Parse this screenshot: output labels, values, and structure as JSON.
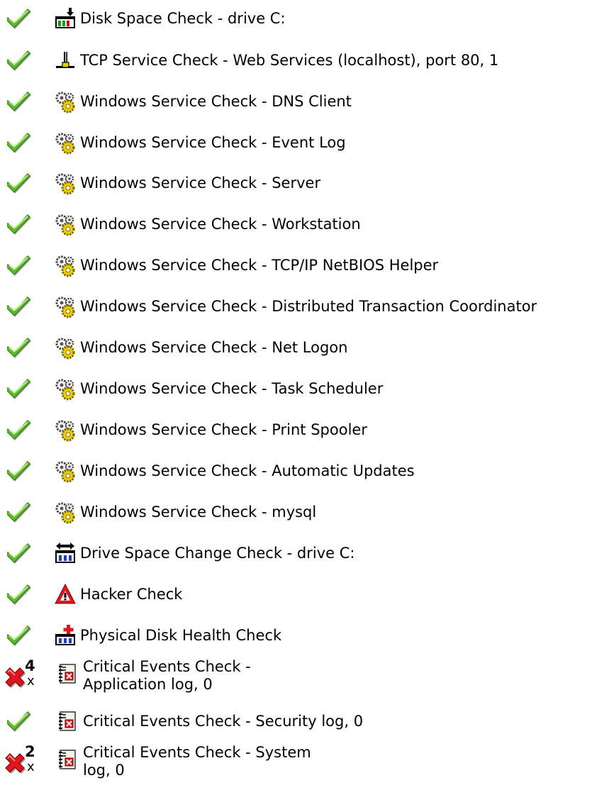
{
  "checks": [
    {
      "status": "ok",
      "icon": "disk-space-icon",
      "label": "Disk Space Check - drive C:"
    },
    {
      "status": "ok",
      "icon": "tcp-port-icon",
      "label": "TCP Service Check - Web Services (localhost), port 80, 1"
    },
    {
      "status": "ok",
      "icon": "gears-icon",
      "label": "Windows Service Check - DNS Client"
    },
    {
      "status": "ok",
      "icon": "gears-icon",
      "label": "Windows Service Check - Event Log"
    },
    {
      "status": "ok",
      "icon": "gears-icon",
      "label": "Windows Service Check - Server"
    },
    {
      "status": "ok",
      "icon": "gears-icon",
      "label": "Windows Service Check - Workstation"
    },
    {
      "status": "ok",
      "icon": "gears-icon",
      "label": "Windows Service Check - TCP/IP NetBIOS Helper"
    },
    {
      "status": "ok",
      "icon": "gears-icon",
      "label": "Windows Service Check - Distributed Transaction Coordinator"
    },
    {
      "status": "ok",
      "icon": "gears-icon",
      "label": "Windows Service Check - Net Logon"
    },
    {
      "status": "ok",
      "icon": "gears-icon",
      "label": "Windows Service Check - Task Scheduler"
    },
    {
      "status": "ok",
      "icon": "gears-icon",
      "label": "Windows Service Check - Print Spooler"
    },
    {
      "status": "ok",
      "icon": "gears-icon",
      "label": "Windows Service Check - Automatic Updates"
    },
    {
      "status": "ok",
      "icon": "gears-icon",
      "label": "Windows Service Check - mysql"
    },
    {
      "status": "ok",
      "icon": "drive-change-icon",
      "label": "Drive Space Change Check - drive C:"
    },
    {
      "status": "ok",
      "icon": "hacker-warning-icon",
      "label": "Hacker Check"
    },
    {
      "status": "ok",
      "icon": "disk-health-icon",
      "label": "Physical Disk Health Check"
    },
    {
      "status": "fail",
      "count": "4",
      "count_suffix": "x",
      "icon": "event-log-icon",
      "label_line1": "Critical Events Check -",
      "label_line2": "Application log, 0"
    },
    {
      "status": "ok",
      "icon": "event-log-icon",
      "label": "Critical Events Check - Security log, 0"
    },
    {
      "status": "fail",
      "count": "2",
      "count_suffix": "x",
      "icon": "event-log-icon",
      "label_line1": "Critical Events Check - System",
      "label_line2": "log, 0"
    }
  ],
  "colors": {
    "ok": "#4caf1f",
    "fail": "#e3151c",
    "text": "#000000"
  }
}
